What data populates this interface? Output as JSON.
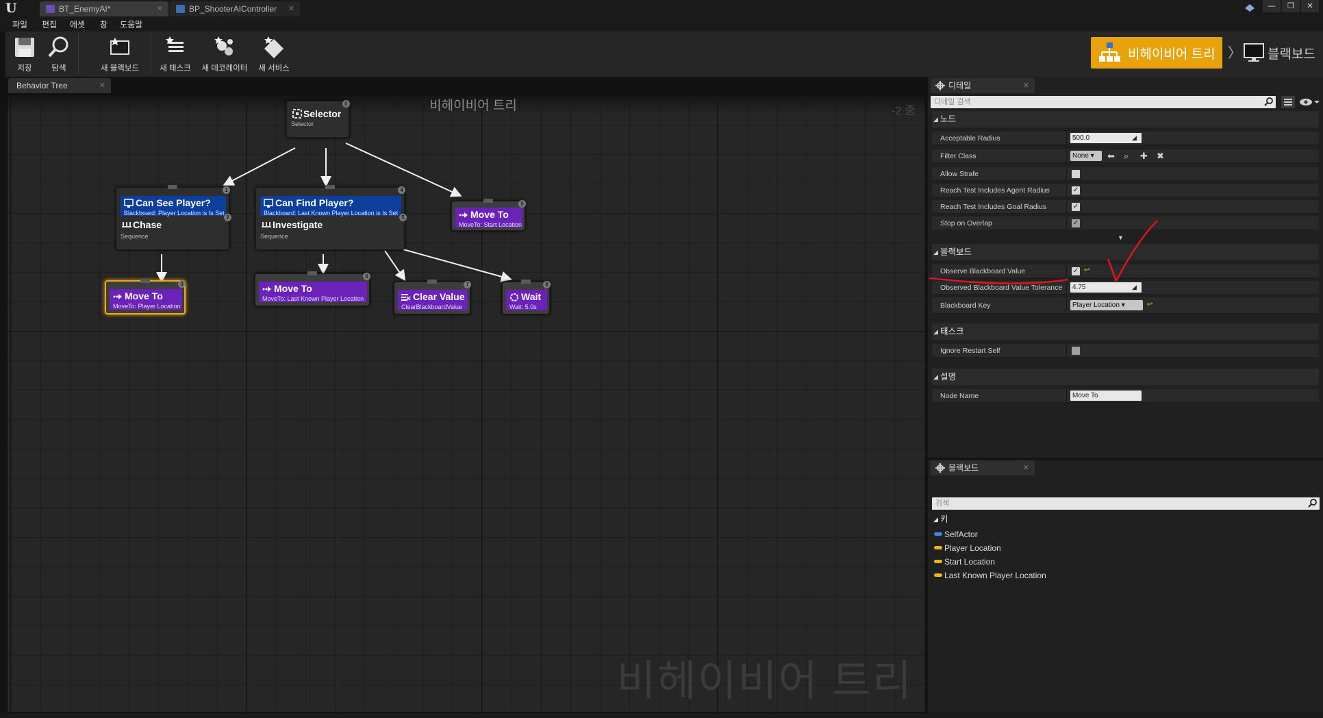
{
  "tabs": [
    {
      "label": "BT_EnemyAI*",
      "active": true
    },
    {
      "label": "BP_ShooterAIController",
      "active": false
    }
  ],
  "menu": [
    "파일",
    "편집",
    "에셋",
    "창",
    "도움말"
  ],
  "toolbar": {
    "save": "저장",
    "browse": "탐색",
    "new_blackboard": "새 블랙보드",
    "new_task": "새 태스크",
    "new_decorator": "새 데코레이터",
    "new_service": "새 서비스"
  },
  "modes": {
    "behavior_tree": "비헤이비어 트리",
    "blackboard": "블랙보드"
  },
  "graph": {
    "tab_label": "Behavior Tree",
    "title": "비헤이비어 트리",
    "zoom": "-2 줌",
    "watermark": "비헤이비어 트리",
    "nodes": {
      "selector": {
        "title": "Selector",
        "sub": "Selector",
        "index": "0"
      },
      "chase": {
        "decorator_title": "Can See Player?",
        "decorator_sub": "Blackboard: Player Location is Is Set",
        "decorator_index": "1",
        "title": "Chase",
        "sub": "Sequence",
        "index": "2"
      },
      "investigate": {
        "decorator_title": "Can Find Player?",
        "decorator_sub": "Blackboard: Last Known Player Location is Is Set",
        "decorator_index": "4",
        "title": "Investigate",
        "sub": "Sequence",
        "index": "5"
      },
      "move_start": {
        "title": "Move To",
        "sub": "MoveTo: Start Location",
        "index": "9"
      },
      "move_player": {
        "title": "Move To",
        "sub": "MoveTo: Player Location",
        "index": "3"
      },
      "move_last": {
        "title": "Move To",
        "sub": "MoveTo: Last Known Player Location",
        "index": "6"
      },
      "clear_value": {
        "title": "Clear Value",
        "sub": "ClearBlackboardValue",
        "index": "7"
      },
      "wait": {
        "title": "Wait",
        "sub": "Wait: 5.0s",
        "index": "8"
      }
    }
  },
  "details": {
    "tab_label": "디테일",
    "search_placeholder": "디테일 검색",
    "node_category": "노드",
    "acceptable_radius_label": "Acceptable Radius",
    "acceptable_radius_value": "500.0",
    "filter_class_label": "Filter Class",
    "filter_class_value": "None",
    "allow_strafe_label": "Allow Strafe",
    "reach_agent_label": "Reach Test Includes Agent Radius",
    "reach_goal_label": "Reach Test Includes Goal Radius",
    "stop_overlap_label": "Stop on Overlap",
    "blackboard_category": "블랙보드",
    "observe_bb_label": "Observe Blackboard Value",
    "observed_tol_label": "Observed Blackboard Value Tolerance",
    "observed_tol_value": "4.75",
    "bb_key_label": "Blackboard Key",
    "bb_key_value": "Player Location",
    "task_category": "태스크",
    "ignore_restart_label": "Ignore Restart Self",
    "desc_category": "설명",
    "node_name_label": "Node Name",
    "node_name_value": "Move To",
    "checks": {
      "allow_strafe": false,
      "reach_agent": true,
      "reach_goal": true,
      "stop_overlap": true,
      "observe_bb": true,
      "ignore_restart": false
    }
  },
  "blackboard_panel": {
    "tab_label": "블랙보드",
    "search_placeholder": "검색",
    "keys_category": "키",
    "keys": [
      "SelfActor",
      "Player Location",
      "Start Location",
      "Last Known Player Location"
    ]
  },
  "colors": {
    "accent": "#e8a30c",
    "decorator": "#0c3f9c",
    "task": "#6a22b8",
    "annotation": "#e0141e"
  }
}
